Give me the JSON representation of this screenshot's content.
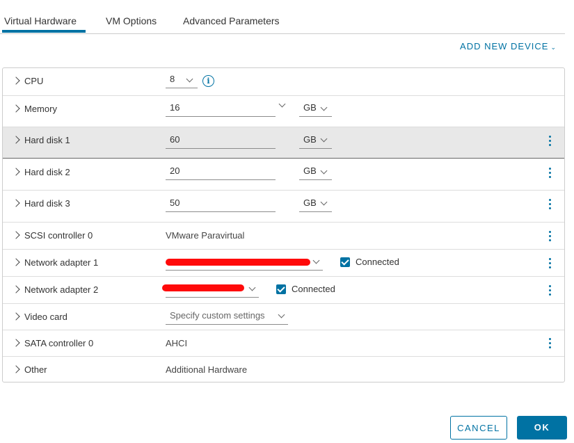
{
  "tabs": [
    {
      "label": "Virtual Hardware",
      "active": true
    },
    {
      "label": "VM Options",
      "active": false
    },
    {
      "label": "Advanced Parameters",
      "active": false
    }
  ],
  "add_new_device": "ADD NEW DEVICE",
  "accent_color": "#0072a3",
  "rows": {
    "cpu": {
      "label": "CPU",
      "value": "8",
      "icon": "info-icon"
    },
    "memory": {
      "label": "Memory",
      "value": "16",
      "unit": "GB"
    },
    "hard_disk_1": {
      "label": "Hard disk 1",
      "value": "60",
      "unit": "GB"
    },
    "hard_disk_2": {
      "label": "Hard disk 2",
      "value": "20",
      "unit": "GB"
    },
    "hard_disk_3": {
      "label": "Hard disk 3",
      "value": "50",
      "unit": "GB"
    },
    "scsi_controller_0": {
      "label": "SCSI controller 0",
      "value": "VMware Paravirtual"
    },
    "network_adapter_1": {
      "label": "Network adapter 1",
      "connected_label": "Connected",
      "connected": true
    },
    "network_adapter_2": {
      "label": "Network adapter 2",
      "connected_label": "Connected",
      "connected": true
    },
    "video_card": {
      "label": "Video card",
      "value": "Specify custom settings"
    },
    "sata_controller_0": {
      "label": "SATA controller 0",
      "value": "AHCI"
    },
    "other": {
      "label": "Other",
      "value": "Additional Hardware"
    }
  },
  "footer": {
    "cancel_label": "CANCEL",
    "ok_label": "OK"
  }
}
